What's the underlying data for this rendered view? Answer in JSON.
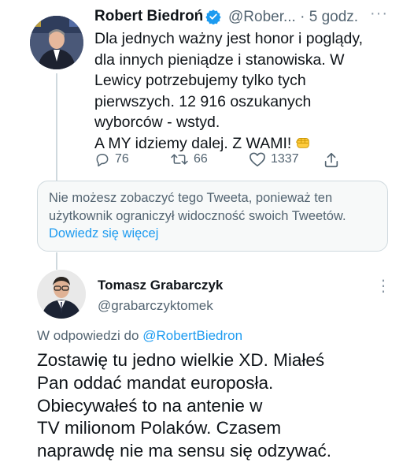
{
  "tweet1": {
    "author_name": "Robert Biedroń",
    "handle": "@Rober...",
    "separator": "·",
    "time": "5 godz.",
    "more_label": "···",
    "text": "Dla jednych ważny jest honor i poglądy,\ndla innych pieniądze i stanowiska. W\nLewicy potrzebujemy tylko tych\npierwszych. 12 916 oszukanych\nwyborców - wstyd.\nA MY idziemy dalej. Z WAMI!",
    "emoji": "raised-fist-emoji",
    "verified_icon": "verified-badge-icon",
    "replies": "76",
    "retweets": "66",
    "likes": "1337"
  },
  "notice": {
    "text": "Nie możesz zobaczyć tego Tweeta, ponieważ ten użytkownik ograniczył widoczność swoich Tweetów.",
    "link": "Dowiedz się więcej"
  },
  "tweet2": {
    "author_name": "Tomasz Grabarczyk",
    "handle": "@grabarczyktomek",
    "more_label": "⋮",
    "reply_prefix": "W odpowiedzi do",
    "reply_to": "@RobertBiedron",
    "text": "Zostawię tu jedno wielkie XD. Miałeś\nPan oddać mandat europosła.\nObiecywałeś to na antenie w\nTV milionom Polaków. Czasem\nnaprawdę nie ma sensu się odzywać."
  },
  "colors": {
    "link": "#1d9bf0",
    "secondary_text": "#536471",
    "primary_text": "#0f1419",
    "verified": "#1d9bf0"
  }
}
